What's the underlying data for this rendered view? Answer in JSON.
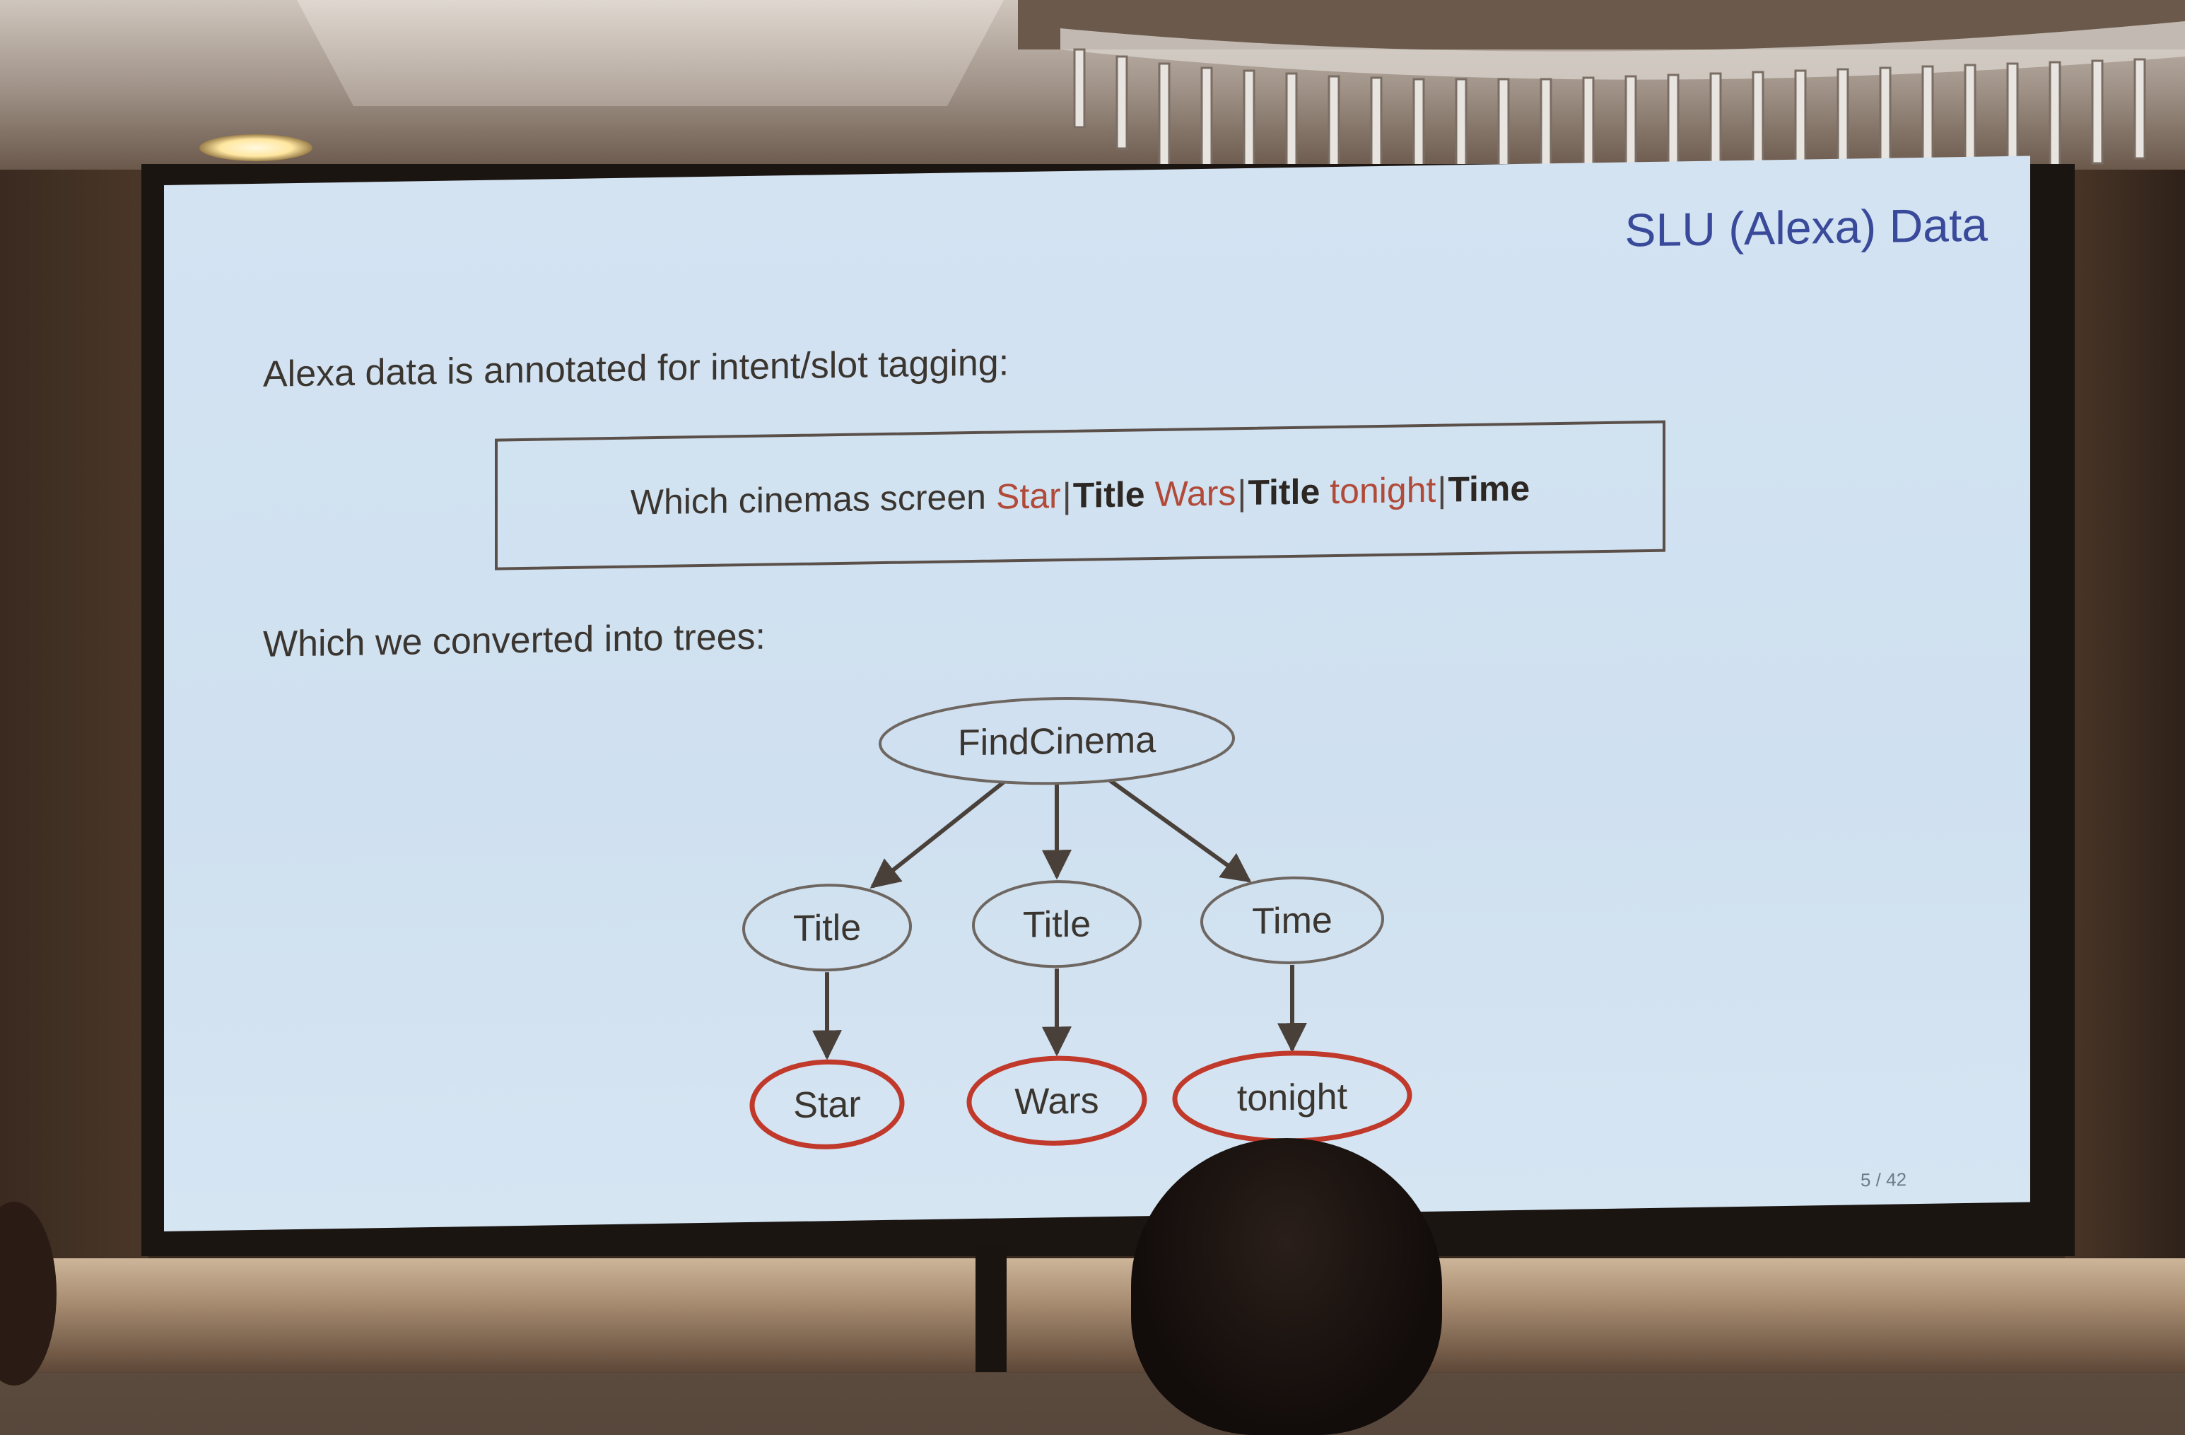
{
  "slide": {
    "title": "SLU (Alexa) Data",
    "intro": "Alexa data is annotated for intent/slot tagging:",
    "example_tokens": [
      {
        "text": "Which",
        "role": "word"
      },
      {
        "text": "cinemas",
        "role": "word"
      },
      {
        "text": "screen",
        "role": "word"
      },
      {
        "text": "Star",
        "role": "slot-word",
        "tag": "Title"
      },
      {
        "text": "Wars",
        "role": "slot-word",
        "tag": "Title"
      },
      {
        "text": "tonight",
        "role": "slot-word",
        "tag": "Time"
      }
    ],
    "conversion_text": "Which we converted into trees:",
    "tree": {
      "root": "FindCinema",
      "slots": [
        {
          "label": "Title",
          "value": "Star"
        },
        {
          "label": "Title",
          "value": "Wars"
        },
        {
          "label": "Time",
          "value": "tonight"
        }
      ]
    },
    "page": "5 / 42"
  },
  "colors": {
    "slide_bg": "#d0e1f1",
    "title": "#3a4a9a",
    "text": "#3b3530",
    "slot_word": "#b14a38",
    "leaf_border": "#c0392b",
    "node_border": "#6e6660",
    "arrow": "#4a403a"
  }
}
